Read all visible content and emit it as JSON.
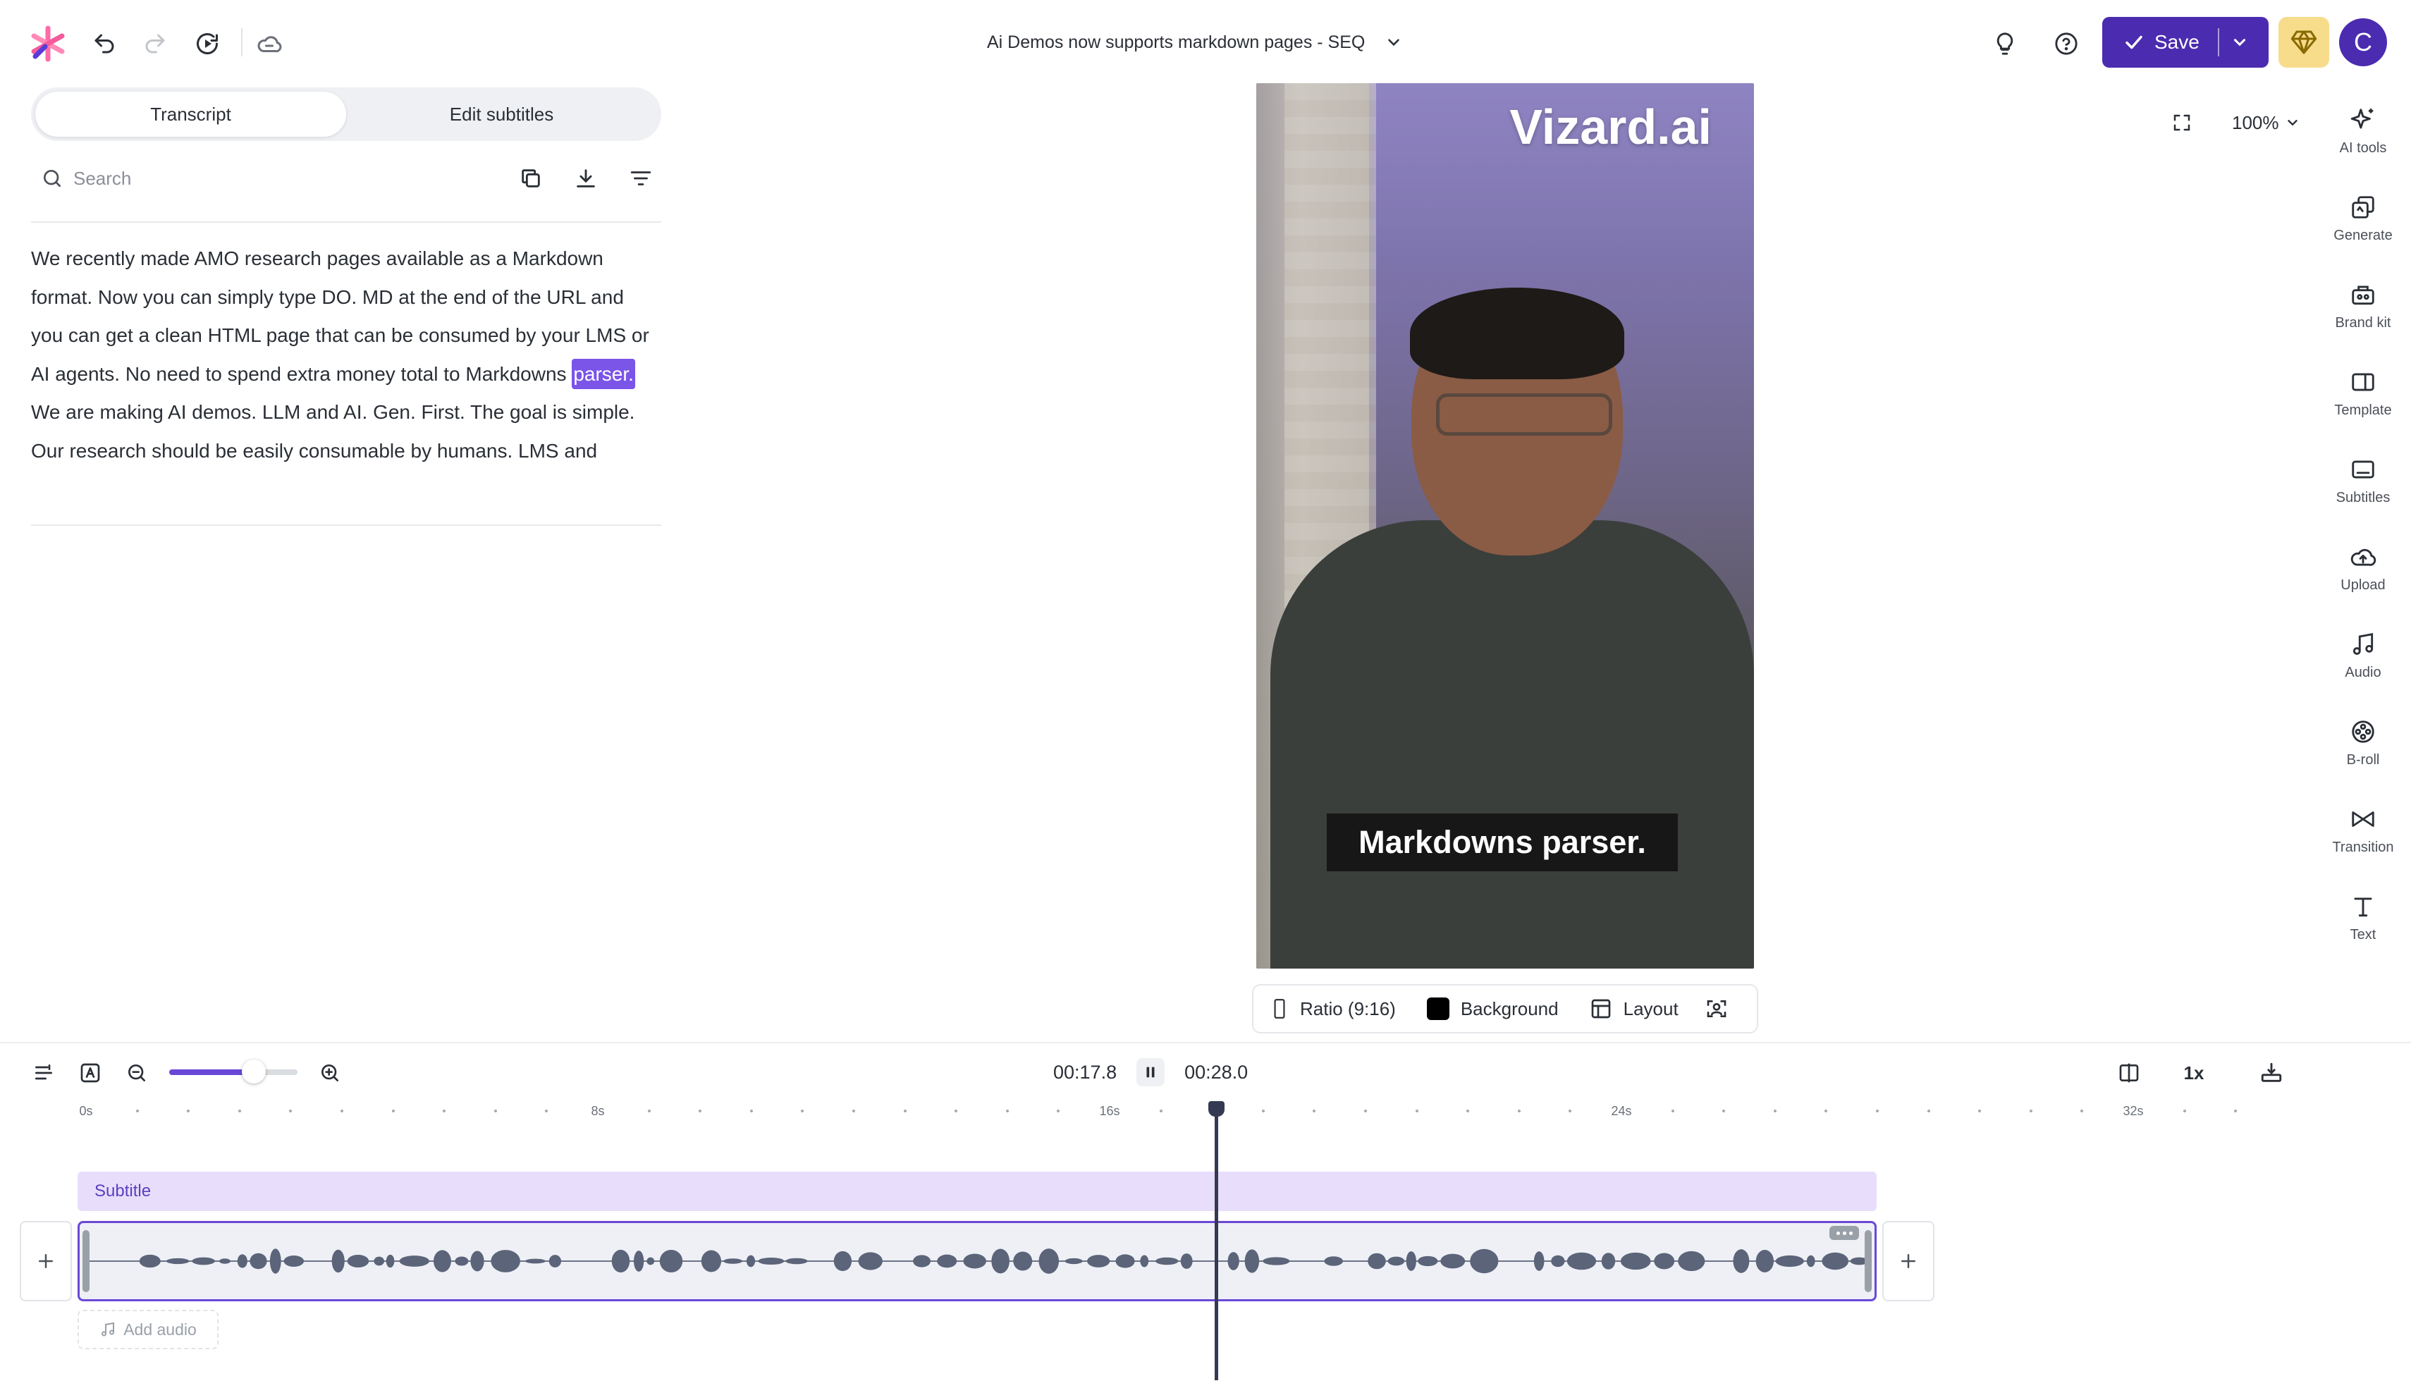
{
  "app": {
    "document_title": "Ai Demos now supports markdown pages - SEQ",
    "save_label": "Save",
    "avatar_initial": "C"
  },
  "left_panel": {
    "tabs": [
      {
        "label": "Transcript",
        "active": true
      },
      {
        "label": "Edit subtitles",
        "active": false
      }
    ],
    "search_placeholder": "Search",
    "transcript_before": "We recently made AMO research pages available as a Markdown format. Now you can simply type DO. MD at the end of the URL and you can get a clean HTML page that can be consumed by your LMS or AI agents. No need to spend extra money total to Markdowns ",
    "transcript_highlight": "parser.",
    "transcript_after": " We are making AI demos. LLM and AI. Gen. First. The goal is simple. Our research should be easily consumable by humans. LMS and"
  },
  "preview": {
    "watermark": "Vizard.ai",
    "caption": "Markdowns parser.",
    "zoom": "100%",
    "controls": {
      "ratio": "Ratio (9:16)",
      "background": "Background",
      "background_color": "#000000",
      "layout": "Layout"
    }
  },
  "right_rail": [
    {
      "label": "AI tools",
      "icon": "sparkle-icon"
    },
    {
      "label": "Generate",
      "icon": "generate-icon"
    },
    {
      "label": "Brand kit",
      "icon": "brand-kit-icon"
    },
    {
      "label": "Template",
      "icon": "template-icon"
    },
    {
      "label": "Subtitles",
      "icon": "subtitles-icon"
    },
    {
      "label": "Upload",
      "icon": "upload-icon"
    },
    {
      "label": "Audio",
      "icon": "music-note-icon"
    },
    {
      "label": "B-roll",
      "icon": "b-roll-icon"
    },
    {
      "label": "Transition",
      "icon": "transition-icon"
    },
    {
      "label": "Text",
      "icon": "text-icon"
    }
  ],
  "timeline": {
    "current_time": "00:17.8",
    "total_time": "00:28.0",
    "speed": "1x",
    "zoom_level": 0.66,
    "ruler_labels": [
      "0s",
      "8s",
      "16s",
      "24s",
      "32s"
    ],
    "subtitle_track_label": "Subtitle",
    "add_audio_label": "Add audio"
  },
  "colors": {
    "accent": "#4b2bb0",
    "highlight": "#7b54e8",
    "subtitle_track": "#e8defc",
    "gem": "#f7dc8c"
  }
}
